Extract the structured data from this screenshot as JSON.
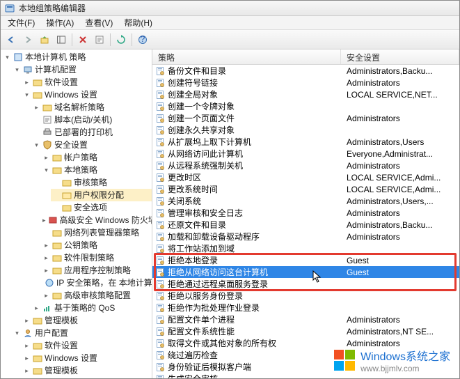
{
  "window": {
    "title": "本地组策略编辑器"
  },
  "menu": {
    "file": "文件(F)",
    "action": "操作(A)",
    "view": "查看(V)",
    "help": "帮助(H)"
  },
  "toolbar_icons": [
    "back-icon",
    "forward-icon",
    "up-icon",
    "show-hide-tree-icon",
    "delete-icon",
    "sep",
    "properties-icon",
    "sep",
    "help-icon"
  ],
  "columns": {
    "policy": "策略",
    "setting": "安全设置"
  },
  "tree": {
    "root": "本地计算机 策略",
    "computer": "计算机配置",
    "software": "软件设置",
    "windows": "Windows 设置",
    "dns": "域名解析策略",
    "scripts": "脚本(启动/关机)",
    "printers": "已部署的打印机",
    "security": "安全设置",
    "account": "帐户策略",
    "local": "本地策略",
    "audit": "审核策略",
    "ura": "用户权限分配",
    "secopt": "安全选项",
    "firewall": "高级安全 Windows 防火墙",
    "nlm": "网络列表管理器策略",
    "pubkey": "公钥策略",
    "srp": "软件限制策略",
    "acp": "应用程序控制策略",
    "ipsec": "IP 安全策略，在 本地计算机",
    "aap": "高级审核策略配置",
    "qos": "基于策略的 QoS",
    "admin": "管理模板",
    "user": "用户配置",
    "usoftware": "软件设置",
    "uwindows": "Windows 设置",
    "uadmin": "管理模板"
  },
  "policies": [
    {
      "policy": "备份文件和目录",
      "setting": "Administrators,Backu..."
    },
    {
      "policy": "创建符号链接",
      "setting": "Administrators"
    },
    {
      "policy": "创建全局对象",
      "setting": "LOCAL SERVICE,NET..."
    },
    {
      "policy": "创建一个令牌对象",
      "setting": ""
    },
    {
      "policy": "创建一个页面文件",
      "setting": "Administrators"
    },
    {
      "policy": "创建永久共享对象",
      "setting": ""
    },
    {
      "policy": "从扩展坞上取下计算机",
      "setting": "Administrators,Users"
    },
    {
      "policy": "从网络访问此计算机",
      "setting": "Everyone,Administrat..."
    },
    {
      "policy": "从远程系统强制关机",
      "setting": "Administrators"
    },
    {
      "policy": "更改时区",
      "setting": "LOCAL SERVICE,Admi..."
    },
    {
      "policy": "更改系统时间",
      "setting": "LOCAL SERVICE,Admi..."
    },
    {
      "policy": "关闭系统",
      "setting": "Administrators,Users,..."
    },
    {
      "policy": "管理审核和安全日志",
      "setting": "Administrators"
    },
    {
      "policy": "还原文件和目录",
      "setting": "Administrators,Backu..."
    },
    {
      "policy": "加载和卸载设备驱动程序",
      "setting": "Administrators"
    },
    {
      "policy": "将工作站添加到域",
      "setting": ""
    },
    {
      "policy": "拒绝本地登录",
      "setting": "Guest"
    },
    {
      "policy": "拒绝从网络访问这台计算机",
      "setting": "Guest"
    },
    {
      "policy": "拒绝通过远程桌面服务登录",
      "setting": ""
    },
    {
      "policy": "拒绝以服务身份登录",
      "setting": ""
    },
    {
      "policy": "拒绝作为批处理作业登录",
      "setting": ""
    },
    {
      "policy": "配置文件单个进程",
      "setting": "Administrators"
    },
    {
      "policy": "配置文件系统性能",
      "setting": "Administrators,NT SE..."
    },
    {
      "policy": "取得文件或其他对象的所有权",
      "setting": "Administrators"
    },
    {
      "policy": "绕过遍历检查",
      "setting": ""
    },
    {
      "policy": "身份验证后模拟客户端",
      "setting": ""
    },
    {
      "policy": "生成安全审核",
      "setting": ""
    }
  ],
  "selected_index": 17,
  "highlight_start": 16,
  "highlight_end": 18,
  "watermark": {
    "line1": "Windows系统之家",
    "line2": "www.bjjmlv.com"
  }
}
